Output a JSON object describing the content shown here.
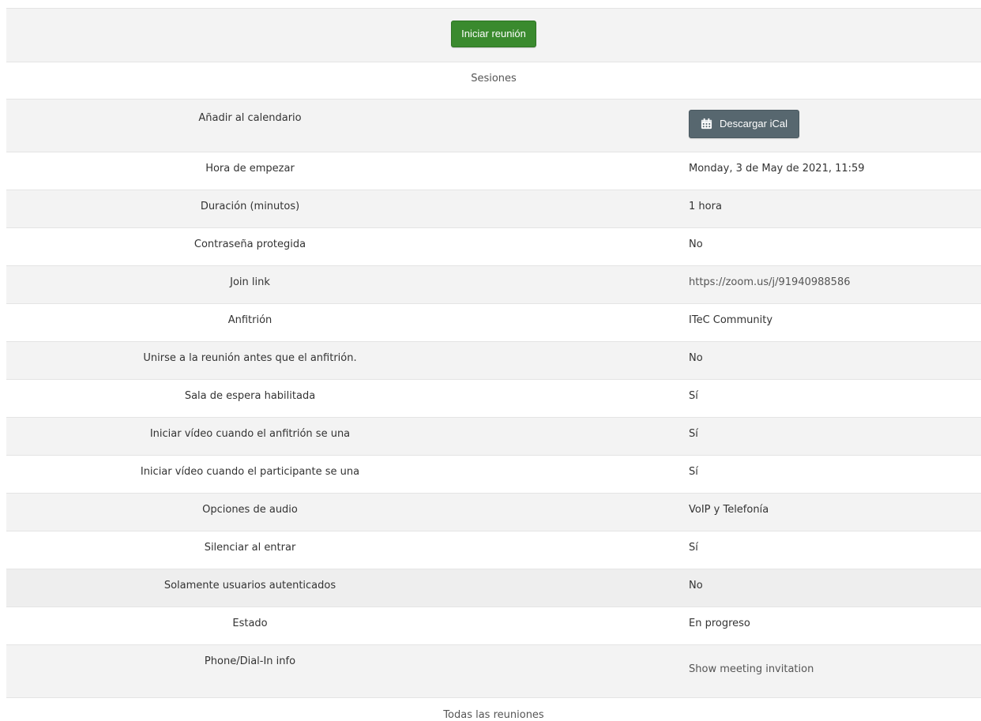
{
  "start_button": "Iniciar reunión",
  "sessions_header": "Sesiones",
  "calendar": {
    "label": "Añadir al calendario",
    "button": "Descargar iCal"
  },
  "rows": [
    {
      "label": "Hora de empezar",
      "value": "Monday, 3 de May de 2021, 11:59"
    },
    {
      "label": "Duración (minutos)",
      "value": "1 hora"
    },
    {
      "label": "Contraseña protegida",
      "value": "No"
    },
    {
      "label": "Join link",
      "value": "https://zoom.us/j/91940988586"
    },
    {
      "label": "Anfitrión",
      "value": "ITeC Community"
    },
    {
      "label": "Unirse a la reunión antes que el anfitrión.",
      "value": "No"
    },
    {
      "label": "Sala de espera habilitada",
      "value": "Sí"
    },
    {
      "label": "Iniciar vídeo cuando el anfitrión se una",
      "value": "Sí"
    },
    {
      "label": "Iniciar vídeo cuando el participante se una",
      "value": "Sí"
    },
    {
      "label": "Opciones de audio",
      "value": "VoIP y Telefonía"
    },
    {
      "label": "Silenciar al entrar",
      "value": "Sí"
    },
    {
      "label": "Solamente usuarios autenticados",
      "value": "No"
    },
    {
      "label": "Estado",
      "value": "En progreso"
    }
  ],
  "phone": {
    "label": "Phone/Dial-In info",
    "value": "Show meeting invitation"
  },
  "footer_link": "Todas las reuniones",
  "colors": {
    "primary": "#3a8a2e",
    "secondary": "#57676f"
  }
}
